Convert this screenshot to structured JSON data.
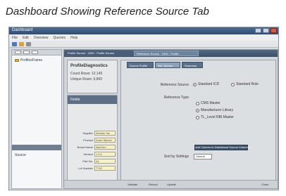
{
  "caption": "Dashboard Showing Reference Source Tab",
  "window": {
    "title": "Dashboard"
  },
  "menu": [
    "File",
    "Edit",
    "Overview",
    "Queries",
    "Help"
  ],
  "left_panel": {
    "tree_item": "ProfilesFrame",
    "secondary_item": "Source"
  },
  "doc_tabs": [
    {
      "label": "Profile Source · 1990 · Profile Source"
    },
    {
      "label": "Reference Source · 1990 · Profile"
    }
  ],
  "info": {
    "title": "ProfileDiagnostics",
    "lines": [
      "Count Rows: 12,145",
      "Unique Rows: 9,860"
    ]
  },
  "fields_panel": {
    "header": "Fields"
  },
  "fields": [
    {
      "label": "Supplier",
      "value": "Zimmer Inc"
    },
    {
      "label": "Product",
      "value": "Knee Sleeve"
    },
    {
      "label": "Brand Name",
      "value": "NexGen"
    },
    {
      "label": "Version",
      "value": "1.0.0"
    },
    {
      "label": "Part No.",
      "value": "A1"
    },
    {
      "label": "Lot Number",
      "value": "7742"
    }
  ],
  "sub_tabs": [
    {
      "label": "Source Profile"
    },
    {
      "label": "Ref. Source"
    },
    {
      "label": "Summary"
    }
  ],
  "form": {
    "reference_source_label": "Reference Source",
    "reference_source_options": [
      "Standard ICD",
      "Standard Role"
    ],
    "reference_type_label": "Reference Type",
    "reference_type_options": [
      "CMS Master",
      "Manufacturer Library",
      "TL_Level RBI Master"
    ],
    "action_button": "Add Column to Dashboard Source Columns",
    "sort_by_label": "Sort by Settings",
    "sort_by_value": "Default"
  },
  "bottom_buttons": [
    "Validate",
    "Reload",
    "Update",
    "Close"
  ]
}
